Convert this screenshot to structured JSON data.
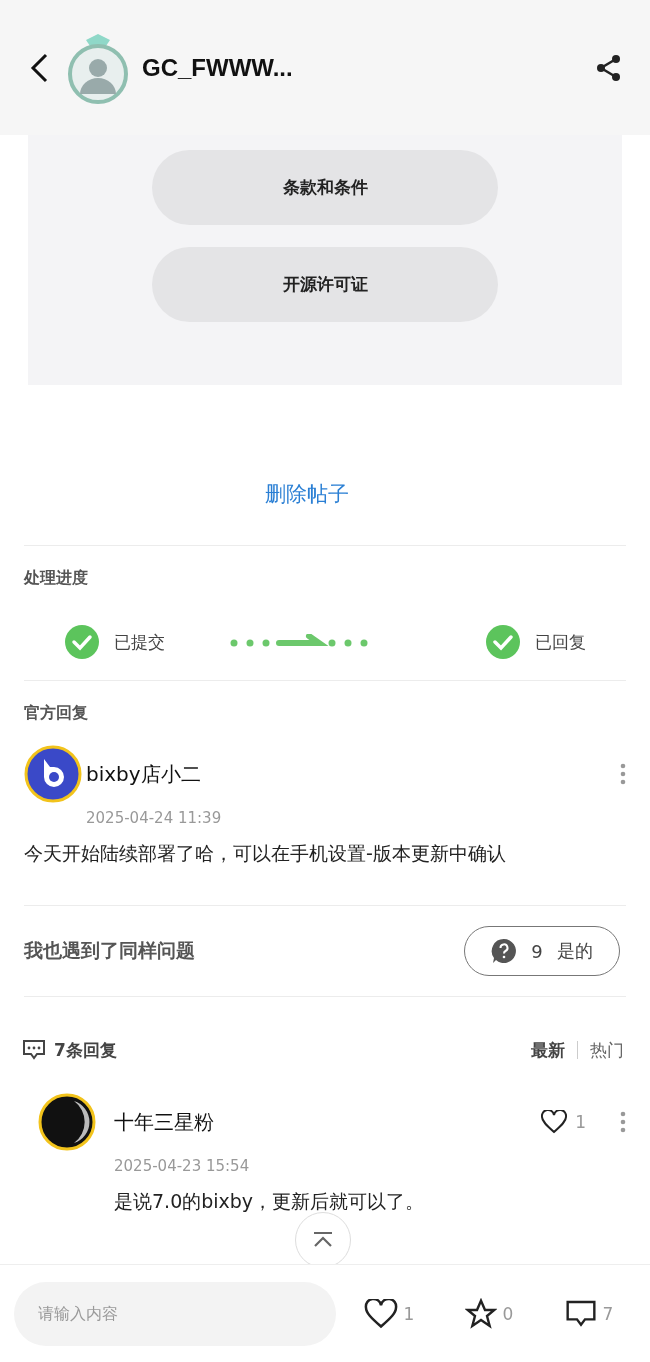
{
  "header": {
    "title": "GC_FWWW..."
  },
  "embedded_screenshot": {
    "buttons": [
      "条款和条件",
      "开源许可证"
    ]
  },
  "delete_link": "删除帖子",
  "progress": {
    "title": "处理进度",
    "steps": [
      {
        "label": "已提交",
        "done": true
      },
      {
        "label": "已回复",
        "done": true
      }
    ]
  },
  "official_reply": {
    "title": "官方回复",
    "author": "bixby店小二",
    "time": "2025-04-24 11:39",
    "text": "今天开始陆续部署了哈，可以在手机设置-版本更新中确认"
  },
  "same_issue": {
    "label": "我也遇到了同样问题",
    "count": "9",
    "button": "是的"
  },
  "replies": {
    "title": "7条回复",
    "sort": [
      {
        "label": "最新",
        "selected": true
      },
      {
        "label": "热门",
        "selected": false
      }
    ],
    "items": [
      {
        "author": "十年三星粉",
        "time": "2025-04-23 15:54",
        "text": "是说7.0的bixby，更新后就可以了。",
        "likes": "1"
      }
    ]
  },
  "bottom_bar": {
    "placeholder": "请输入内容",
    "likes": "1",
    "stars": "0",
    "comments": "7"
  }
}
